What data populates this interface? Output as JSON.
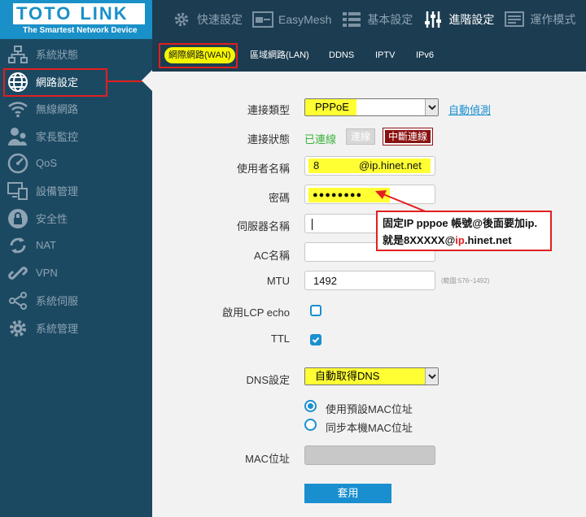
{
  "logo": {
    "brand_left": "TOTO",
    "brand_right": "LINK",
    "tagline": "The Smartest Network Device"
  },
  "topnav": [
    {
      "label": "快速設定",
      "icon": "gear-icon"
    },
    {
      "label": "EasyMesh",
      "icon": "mesh-icon"
    },
    {
      "label": "基本設定",
      "icon": "list-icon"
    },
    {
      "label": "進階設定",
      "icon": "sliders-icon",
      "active": true
    },
    {
      "label": "運作模式",
      "icon": "mode-icon"
    }
  ],
  "sidebar": {
    "items": [
      {
        "label": "系統狀態",
        "icon": "network-status-icon"
      },
      {
        "label": "網路設定",
        "icon": "globe-icon",
        "active": true
      },
      {
        "label": "無線網路",
        "icon": "wifi-icon"
      },
      {
        "label": "家長監控",
        "icon": "parental-icon"
      },
      {
        "label": "QoS",
        "icon": "speedometer-icon"
      },
      {
        "label": "設備管理",
        "icon": "devices-icon"
      },
      {
        "label": "安全性",
        "icon": "lock-icon"
      },
      {
        "label": "NAT",
        "icon": "refresh-icon"
      },
      {
        "label": "VPN",
        "icon": "link-icon"
      },
      {
        "label": "系統伺服",
        "icon": "share-icon"
      },
      {
        "label": "系統管理",
        "icon": "settings-icon"
      }
    ]
  },
  "tabs": [
    {
      "label": "網際網路(WAN)",
      "active": true
    },
    {
      "label": "區域網路(LAN)"
    },
    {
      "label": "DDNS"
    },
    {
      "label": "IPTV"
    },
    {
      "label": "IPv6"
    }
  ],
  "form": {
    "conn_type_label": "連接類型",
    "conn_type_value": "PPPoE",
    "auto_detect": "自動偵測",
    "conn_status_label": "連接狀態",
    "conn_status_value": "已連線",
    "connect_btn": "連線",
    "disconnect_btn": "中斷連線",
    "username_label": "使用者名稱",
    "username_prefix": "8",
    "username_suffix": "@ip.hinet.net",
    "password_label": "密碼",
    "password_value": "●●●●●●●●",
    "server_label": "伺服器名稱",
    "ac_label": "AC名稱",
    "mtu_label": "MTU",
    "mtu_value": "1492",
    "mtu_hint": "(範圍:576~1492)",
    "lcp_label": "啟用LCP echo",
    "lcp_checked": false,
    "ttl_label": "TTL",
    "ttl_checked": true,
    "dns_label": "DNS設定",
    "dns_value": "自動取得DNS",
    "mac_option_default": "使用預設MAC位址",
    "mac_option_clone": "同步本機MAC位址",
    "mac_label": "MAC位址",
    "apply_btn": "套用"
  },
  "annotation": {
    "line1": "固定IP pppoe 帳號@後面要加ip.",
    "line2_prefix": "就是8XXXXX@",
    "line2_red": "ip",
    "line2_suffix": ".hinet.net"
  },
  "colors": {
    "accent": "#1a8fd0",
    "highlight": "#ffff33",
    "annotation_red": "#e21f1f",
    "sidebar_bg": "#1c4962"
  }
}
